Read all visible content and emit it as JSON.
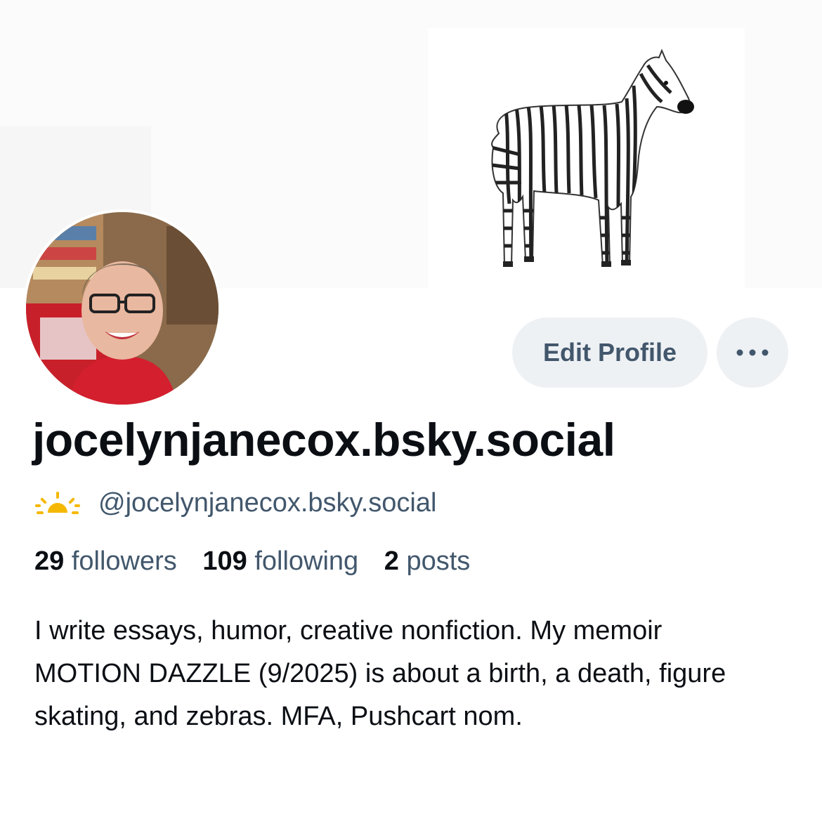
{
  "profile": {
    "display_name": "jocelynjanecox.bsky.social",
    "handle": "@jocelynjanecox.bsky.social",
    "bio": "I write essays, humor, creative nonfiction. My memoir MOTION DAZZLE (9/2025) is about a birth, a death, figure skating, and zebras. MFA, Pushcart nom.",
    "banner_icon": "zebra-illustration",
    "avatar_icon": "profile-photo",
    "handle_icon": "sun-icon"
  },
  "stats": {
    "followers_count": "29",
    "followers_label": "followers",
    "following_count": "109",
    "following_label": "following",
    "posts_count": "2",
    "posts_label": "posts"
  },
  "actions": {
    "edit_label": "Edit Profile",
    "more_icon": "ellipsis-icon"
  },
  "colors": {
    "muted_text": "#42576c",
    "button_bg": "#eef1f4",
    "sun_accent": "#f5b800"
  }
}
